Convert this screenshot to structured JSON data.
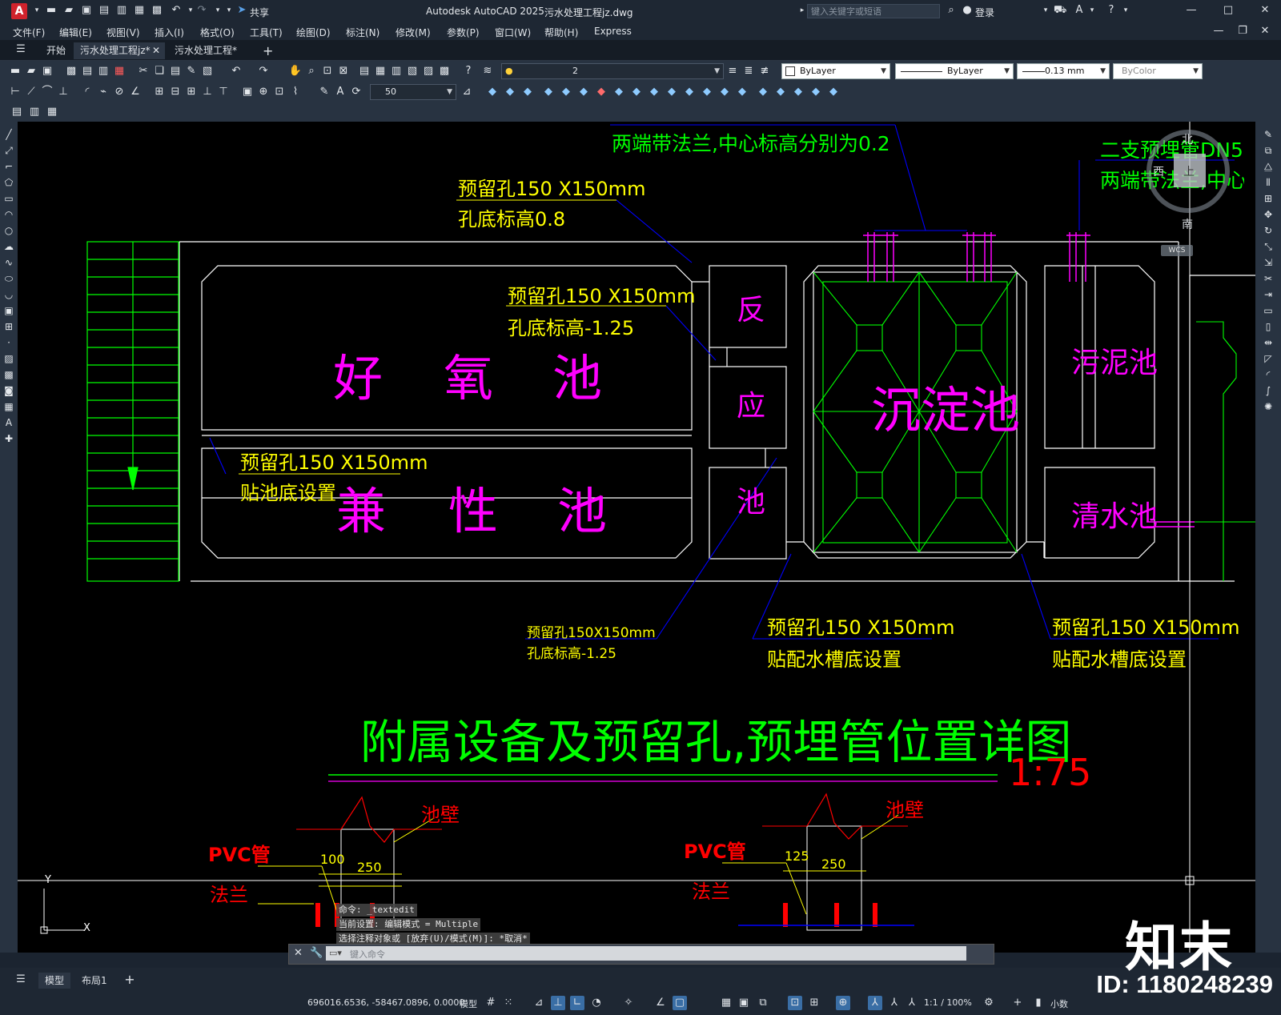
{
  "app": {
    "logo_letter": "A",
    "title": "Autodesk AutoCAD 2025",
    "filename": "污水处理工程jz.dwg",
    "share_label": "共享",
    "search_placeholder": "键入关键字或短语",
    "login_label": "登录"
  },
  "menu": [
    "文件(F)",
    "编辑(E)",
    "视图(V)",
    "插入(I)",
    "格式(O)",
    "工具(T)",
    "绘图(D)",
    "标注(N)",
    "修改(M)",
    "参数(P)",
    "窗口(W)",
    "帮助(H)",
    "Express"
  ],
  "tabs": {
    "start": "开始",
    "active": "污水处理工程jz*",
    "second": "污水处理工程*",
    "add": "+"
  },
  "toolbar": {
    "layer_name": "2",
    "color": "ByLayer",
    "linetype": "ByLayer",
    "lineweight": "0.13 mm",
    "plotstyle": "ByColor",
    "dim_scale": "50"
  },
  "drawing": {
    "title": "附属设备及预留孔,预埋管位置详图",
    "scale": "1:75",
    "tanks": {
      "aerobic": [
        "好",
        "氧",
        "池"
      ],
      "facultative": [
        "兼",
        "性",
        "池"
      ],
      "reaction": [
        "反",
        "应",
        "池"
      ],
      "sedimentation": "沉淀池",
      "sludge": "污泥池",
      "clear_water": "清水池"
    },
    "notes": {
      "top_flange": "两端带法兰,中心标高分别为0.2",
      "top_right_1": "二支预埋管DN5",
      "top_right_2": "两端带法兰,中心",
      "hole1_a": "预留孔150 X150mm",
      "hole1_b": "孔底标高0.8",
      "hole2_a": "预留孔150 X150mm",
      "hole2_b": "孔底标高-1.25",
      "hole3_a": "预留孔150 X150mm",
      "hole3_b": "贴池底设置",
      "hole4_a": "预留孔150X150mm",
      "hole4_b": "孔底标高-1.25",
      "hole5_a": "预留孔150 X150mm",
      "hole5_b": "贴配水槽底设置",
      "hole6_a": "预留孔150 X150mm",
      "hole6_b": "贴配水槽底设置"
    },
    "details": {
      "pvc_label": "PVC管",
      "flange_label": "法兰",
      "wall_label": "池壁",
      "left_dim_a": "100",
      "left_dim_b": "250",
      "right_dim_a": "125",
      "right_dim_b": "250"
    },
    "ucs_y": "Y",
    "ucs_x": "X"
  },
  "viewcube": {
    "north": "北",
    "south": "南",
    "top": "上",
    "west": "西",
    "wcs": "WCS"
  },
  "command": {
    "history": [
      "命令:  _textedit",
      "当前设置: 编辑模式 = Multiple",
      "选择注释对象或 [放弃(U)/模式(M)]: *取消*"
    ],
    "placeholder": "键入命令"
  },
  "layout_tabs": [
    "模型",
    "布局1"
  ],
  "status": {
    "coordinates": "696016.6536, -58467.0896, 0.0000",
    "mode": "模型",
    "scale": "1:1 / 100%",
    "units": "小数"
  },
  "watermark": {
    "id": "ID: 1180248239",
    "brand": "知末"
  },
  "colors": {
    "canvas_bg": "#000000",
    "green": "#00ff00",
    "magenta": "#ff00ff",
    "yellow": "#ffff00",
    "red": "#ff0000",
    "blue": "#0000ff",
    "white": "#ffffff"
  }
}
